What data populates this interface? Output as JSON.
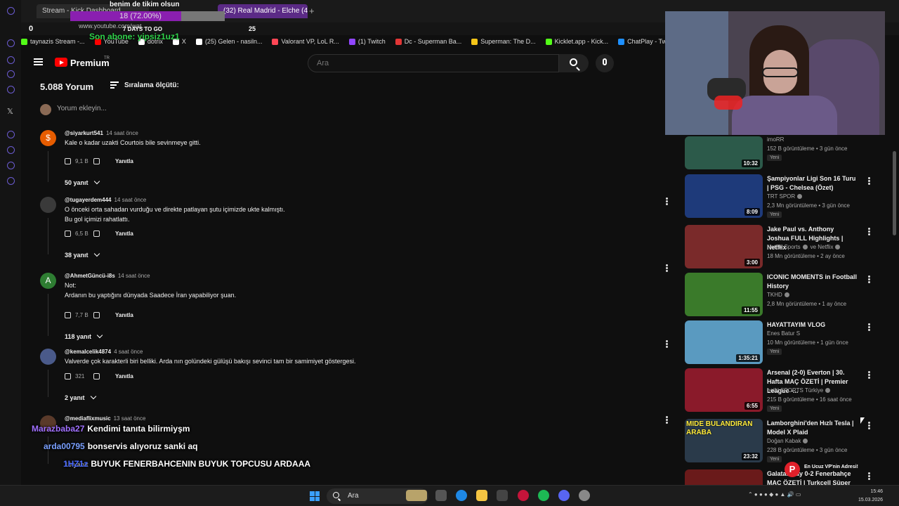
{
  "browser": {
    "tab_kick": "Stream - Kick Dashboard",
    "tab_real": "(32) Real Madrid - Elche (4",
    "url": "www.youtube.com/wat...",
    "bookmarks": [
      {
        "label": "taynazis Stream -...",
        "color": "#53fc18"
      },
      {
        "label": "YouTube",
        "color": "#ff0000"
      },
      {
        "label": "dotrix",
        "color": "#ffffff"
      },
      {
        "label": "X",
        "color": "#ffffff"
      },
      {
        "label": "(25) Gelen - nasiln...",
        "color": "#ffffff"
      },
      {
        "label": "Valorant VP, LoL R...",
        "color": "#ff4655"
      },
      {
        "label": "(1) Twitch",
        "color": "#9146ff"
      },
      {
        "label": "Dc - Superman Ba...",
        "color": "#e23636"
      },
      {
        "label": "Superman: The D...",
        "color": "#f5c518"
      },
      {
        "label": "Kicklet.app - Kick...",
        "color": "#53fc18"
      },
      {
        "label": "ChatPlay - Twitch...",
        "color": "#1e90ff"
      }
    ]
  },
  "overlay": {
    "top_text": "benim de tikim olsun",
    "progress_text": "18 (72.00%)",
    "progress_fraction": 0.72,
    "zero": "0",
    "days": "7 DAYS TO GO",
    "goal": "25",
    "subscriber": "Son abone: yipsiz1uz1"
  },
  "header": {
    "brand": "Premium",
    "region": "TR",
    "search_placeholder": "Ara"
  },
  "comments_header": {
    "count": "5.088 Yorum",
    "sort_label": "Sıralama ölçütü:",
    "add_placeholder": "Yorum ekleyin..."
  },
  "comments": [
    {
      "avatar": "$",
      "color": "#e65c00",
      "user": "@siyarkurt541",
      "time": "14 saat önce",
      "text": "Kale o kadar uzakti Courtois bile sevinmeye gitti.",
      "likes": "9,1 B",
      "reply": "Yanıtla",
      "replies": "50 yanıt"
    },
    {
      "avatar": "",
      "color": "#3a3a3a",
      "user": "@tugayerdem444",
      "time": "14 saat önce",
      "text": "O önceki orta sahadan vurduğu ve direkte patlayan şutu içimizde ukte kalmıştı.\nBu gol içimizi rahatlattı.",
      "likes": "6,5 B",
      "reply": "Yanıtla",
      "replies": "38 yanıt"
    },
    {
      "avatar": "A",
      "color": "#2e7d32",
      "user": "@AhmetGüncü-i8s",
      "time": "14 saat önce",
      "text": "Not:\nArdanın bu yaptığını dünyada Saadece İran yapabiliyor şuan.",
      "likes": "7,7 B",
      "reply": "Yanıtla",
      "replies": "118 yanıt"
    },
    {
      "avatar": "",
      "color": "#4a5a8a",
      "user": "@kemalcelik4874",
      "time": "4 saat önce",
      "text": "Valverde çok karakterli biri belliki. Arda nın golündeki gülüşü bakışı sevinci tam bir samimiyet göstergesi.",
      "likes": "321",
      "reply": "Yanıtla",
      "replies": "2 yanıt"
    },
    {
      "avatar": "",
      "color": "#5a3a2a",
      "user": "@mediaflixmusic",
      "time": "13 saat önce",
      "text": "",
      "likes": "",
      "reply": "",
      "replies": "15 yanıt"
    }
  ],
  "chat": [
    {
      "name": "Marazbaba27",
      "message": "Kendimi tanıta bilirmiyşm",
      "color": "#a070ff"
    },
    {
      "name": "arda00795",
      "message": "bonservis alıyoruz sanki aq",
      "color": "#7aa0ff"
    },
    {
      "name": "1HZ1z",
      "message": "BUYUK FENERBAHCENIN BUYUK TOPCUSU ARDAAA",
      "color": "#4a6aff"
    }
  ],
  "related": [
    {
      "title": "",
      "channel": "imoRR",
      "meta": "152 B görüntüleme • 3 gün önce",
      "badge": "Yeni",
      "duration": "10:32",
      "thumb": "#2c5a4a",
      "verified": false
    },
    {
      "title": "Şampiyonlar Ligi Son 16 Turu | PSG - Chelsea (Özet)",
      "channel": "TRT SPOR",
      "meta": "2,3 Mn görüntüleme • 3 gün önce",
      "badge": "Yeni",
      "duration": "8:09",
      "thumb": "#1e3a7a",
      "verified": true
    },
    {
      "title": "Jake Paul vs. Anthony Joshua FULL Highlights | Netflix",
      "channel": "Netflix Sports",
      "channel2": "ve Netflix",
      "meta": "18 Mn görüntüleme • 2 ay önce",
      "badge": "",
      "duration": "3:00",
      "thumb": "#7a2a2a",
      "verified": true
    },
    {
      "title": "ICONIC MOMENTS in Football History",
      "channel": "TKHD",
      "meta": "2,8 Mn görüntüleme • 1 ay önce",
      "badge": "",
      "duration": "11:55",
      "thumb": "#3a7a2a",
      "verified": true
    },
    {
      "title": "HAYATTAYIM VLOG",
      "channel": "Enes Batur S",
      "meta": "10 Mn görüntüleme • 1 gün önce",
      "badge": "Yeni",
      "duration": "1:35:21",
      "thumb": "#5a9ac0",
      "verified": false
    },
    {
      "title": "Arsenal (2-0) Everton | 30. Hafta MAÇ ÖZETİ | Premier League -...",
      "channel": "beIN SPORTS Türkiye",
      "meta": "215 B görüntüleme • 16 saat önce",
      "badge": "Yeni",
      "duration": "6:55",
      "thumb": "#8a1a2a",
      "verified": true
    },
    {
      "title": "Lamborghini'den Hızlı Tesla | Model X Plaid",
      "channel": "Doğan Kabak",
      "meta": "228 B görüntüleme • 3 gün önce",
      "badge": "Yeni",
      "duration": "23:32",
      "thumb": "#2a3a4a",
      "verified": true,
      "thumb_text": "MIDE BULANDIRAN ARABA"
    },
    {
      "title": "Galatasaray 0-2 Fenerbahçe MAÇ ÖZETİ | Turkcell Süper",
      "channel": "",
      "meta": "",
      "badge": "",
      "duration": "",
      "thumb": "#6a1a1a",
      "verified": false
    }
  ],
  "promo": {
    "letter": "P",
    "text": "En Ucuz VP'nin Adresi!"
  },
  "taskbar": {
    "search": "Ara",
    "time": "15:46",
    "date": "15.03.2026"
  }
}
